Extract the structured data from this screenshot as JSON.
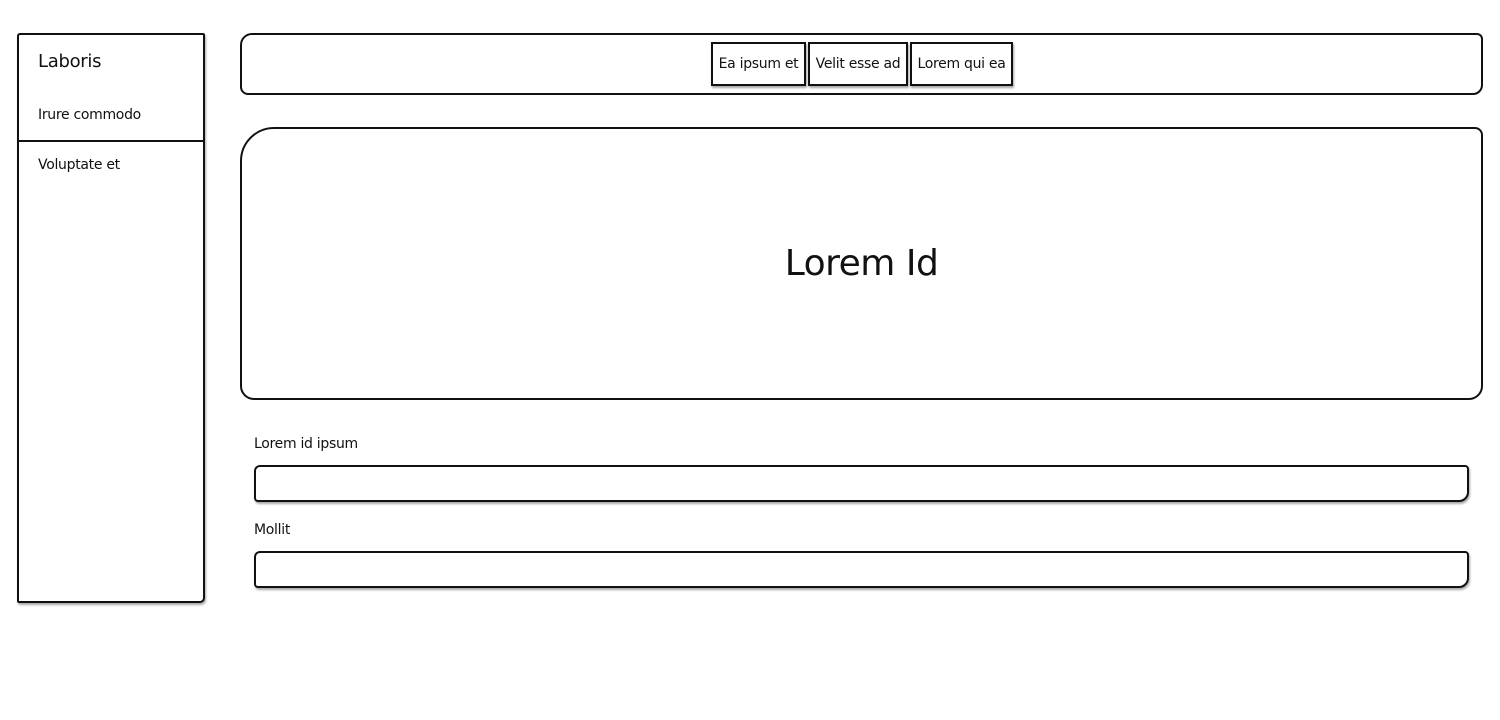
{
  "sidebar": {
    "title": "Laboris",
    "items": [
      {
        "label": "Irure commodo"
      },
      {
        "label": "Voluptate et"
      }
    ]
  },
  "toolbar": {
    "tabs": [
      {
        "label": "Ea ipsum et"
      },
      {
        "label": "Velit esse ad"
      },
      {
        "label": "Lorem qui ea"
      }
    ]
  },
  "hero": {
    "title": "Lorem Id"
  },
  "form": {
    "fields": [
      {
        "label": "Lorem id ipsum",
        "value": "",
        "placeholder": ""
      },
      {
        "label": "Mollit",
        "value": "",
        "placeholder": ""
      }
    ]
  }
}
